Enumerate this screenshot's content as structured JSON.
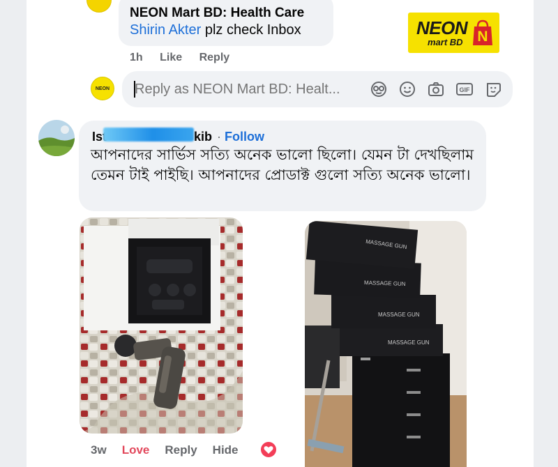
{
  "top_comment": {
    "author": "NEON Mart BD: Health Care",
    "mention": "Shirin Akter",
    "text": " plz check Inbox",
    "time": "1h",
    "like_label": "Like",
    "reply_label": "Reply"
  },
  "brand_logo": {
    "wordmark": "NEON",
    "subtitle": "mart BD",
    "bag_letter": "N",
    "color": "#f6e100"
  },
  "composer": {
    "avatar_text": "NEON",
    "placeholder": "Reply as NEON Mart BD: Healt...",
    "icons": [
      "sticker-icon",
      "emoji-icon",
      "camera-icon",
      "gif-icon",
      "avatar-sticker-icon"
    ]
  },
  "comment2": {
    "author_visible_start": "Ist",
    "author_visible_end": "kib",
    "separator": "·",
    "follow_label": "Follow",
    "text": "আপনাদের সার্ভিস সত্যি অনেক ভালো ছিলো। যেমন টা দেখছিলাম তেমন টাই পাইছি। আপনাদের প্রোডাক্ট গুলো সত্যি অনেক ভালো।",
    "time": "3w",
    "love_label": "Love",
    "reply_label": "Reply",
    "hide_label": "Hide",
    "reaction": "love-reaction"
  },
  "photos": {
    "box_labels": [
      "MASSAGE GUN",
      "MASSAGE GUN",
      "MASSAGE GUN",
      "MASSAGE GUN"
    ]
  },
  "colors": {
    "link": "#1d6fd8",
    "love": "#e2475b",
    "bubble": "#f0f2f5",
    "muted": "#65676b"
  }
}
